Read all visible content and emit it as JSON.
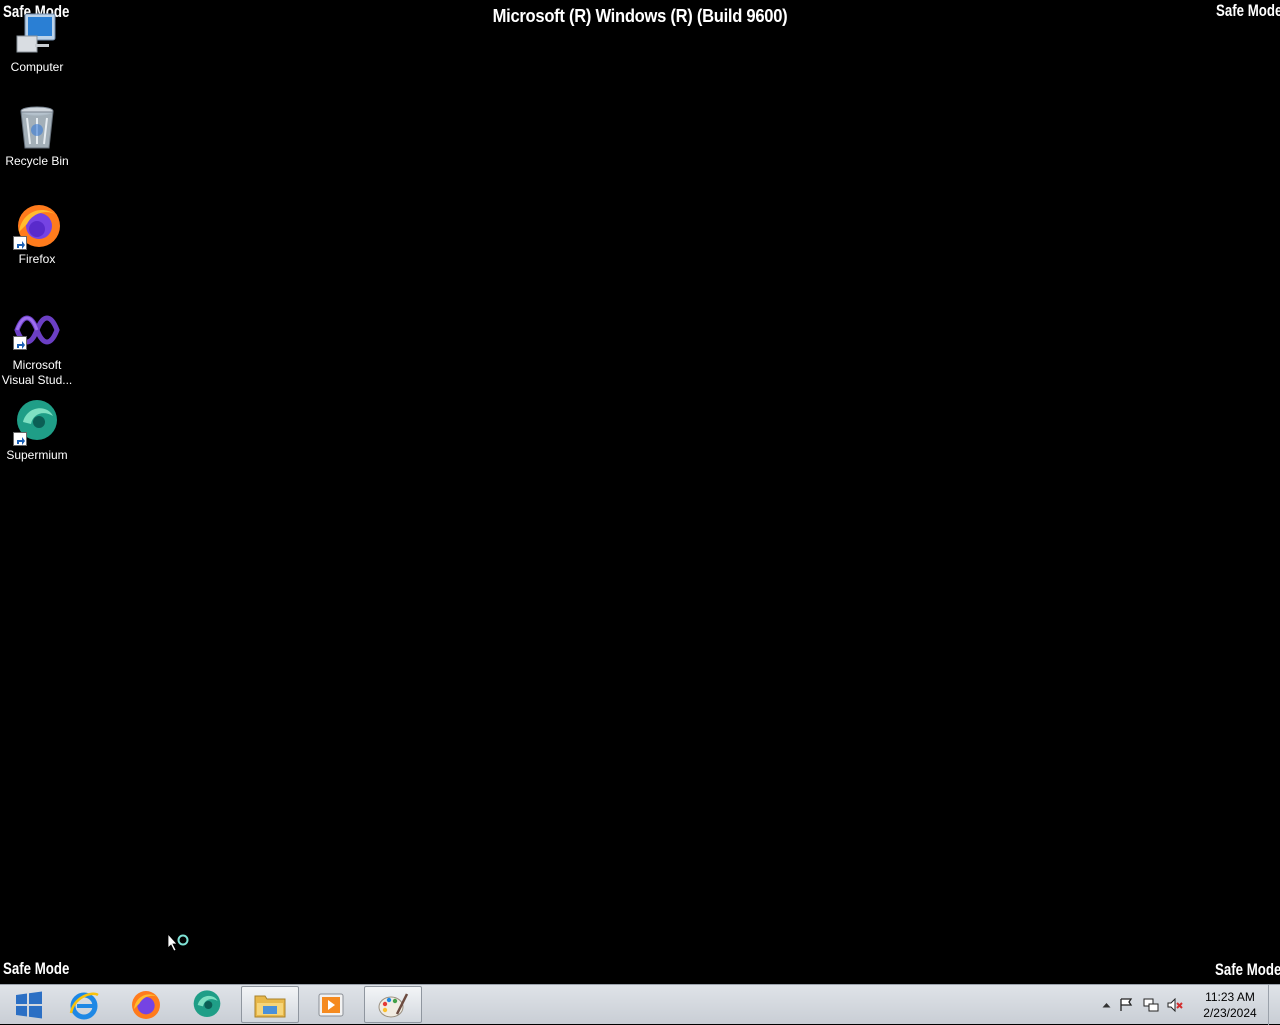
{
  "screen": {
    "build_title": "Microsoft (R) Windows (R) (Build 9600)",
    "safe_mode_label": "Safe Mode"
  },
  "desktop_icons": [
    {
      "label": "Computer",
      "icon": "computer-icon"
    },
    {
      "label": "Recycle Bin",
      "icon": "recycle-bin-icon"
    },
    {
      "label": "Firefox",
      "icon": "firefox-icon"
    },
    {
      "label": "Microsoft Visual Stud...",
      "icon": "visual-studio-icon"
    },
    {
      "label": "Supermium",
      "icon": "supermium-icon"
    }
  ],
  "taskbar": {
    "pinned": [
      {
        "icon": "start-icon"
      },
      {
        "icon": "internet-explorer-icon"
      },
      {
        "icon": "firefox-icon"
      },
      {
        "icon": "supermium-icon"
      },
      {
        "icon": "file-explorer-icon"
      },
      {
        "icon": "media-player-icon"
      },
      {
        "icon": "paint-icon"
      }
    ],
    "tray_icons": [
      "show-hidden-icons-icon",
      "flag-icon",
      "network-icon",
      "volume-muted-icon"
    ],
    "clock": {
      "time": "11:23 AM",
      "date": "2/23/2024"
    }
  },
  "colors": {
    "desktop_background": "#000000",
    "taskbar": "#d3d8de"
  }
}
